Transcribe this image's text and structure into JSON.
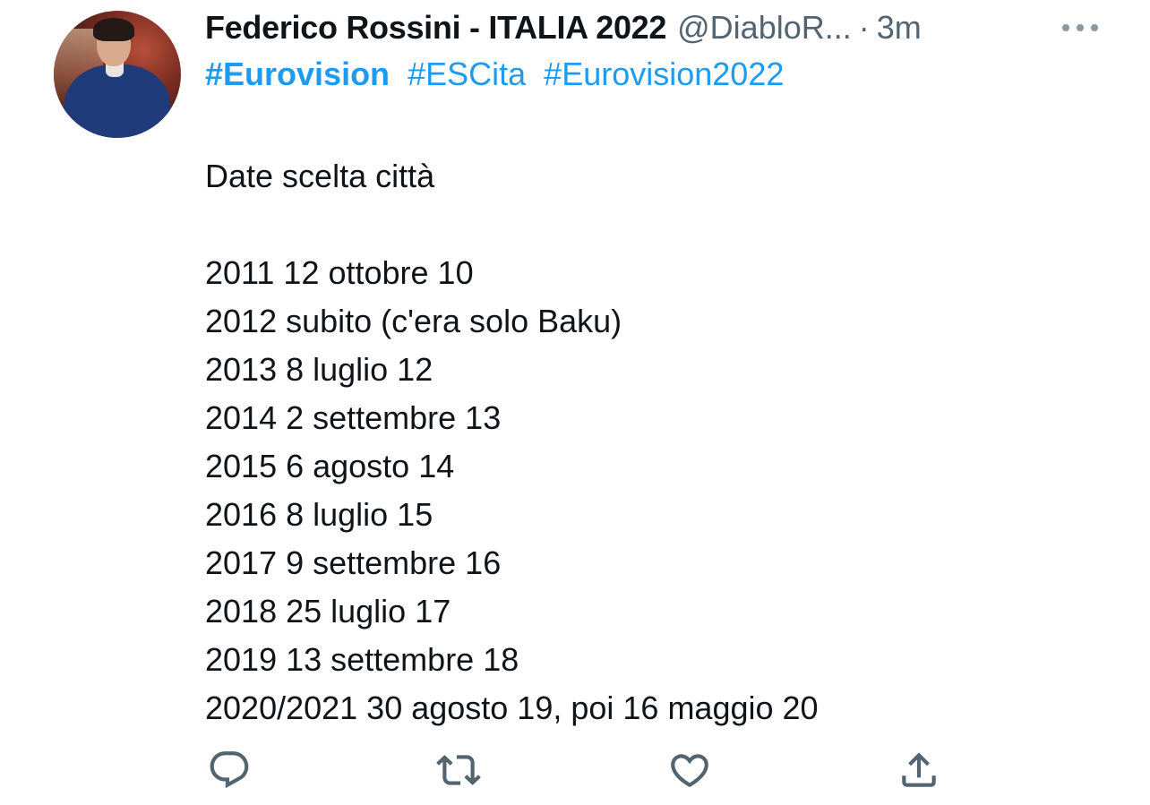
{
  "tweet": {
    "author": {
      "name": "Federico Rossini - ITALIA 2022",
      "handle": "@DiabloR...",
      "separator": "·",
      "time": "3m"
    },
    "hashtags": [
      {
        "text": "#Eurovision",
        "bold": true
      },
      {
        "text": "#ESCita",
        "bold": false
      },
      {
        "text": "#Eurovision2022",
        "bold": false
      }
    ],
    "title": "Date scelta città",
    "lines": [
      "2011 12 ottobre 10",
      "2012 subito (c'era solo Baku)",
      "2013 8 luglio 12",
      "2014 2 settembre 13",
      "2015 6 agosto 14",
      "2016 8 luglio 15",
      "2017 9 settembre 16",
      "2018 25 luglio 17",
      "2019 13 settembre 18",
      "2020/2021 30 agosto 19, poi 16 maggio 20"
    ]
  },
  "actions": [
    {
      "name": "reply-icon"
    },
    {
      "name": "retweet-icon"
    },
    {
      "name": "like-icon"
    },
    {
      "name": "share-icon"
    }
  ],
  "colors": {
    "text": "#0f1419",
    "secondary": "#536471",
    "link": "#1d9bf0",
    "icon": "#536471"
  }
}
